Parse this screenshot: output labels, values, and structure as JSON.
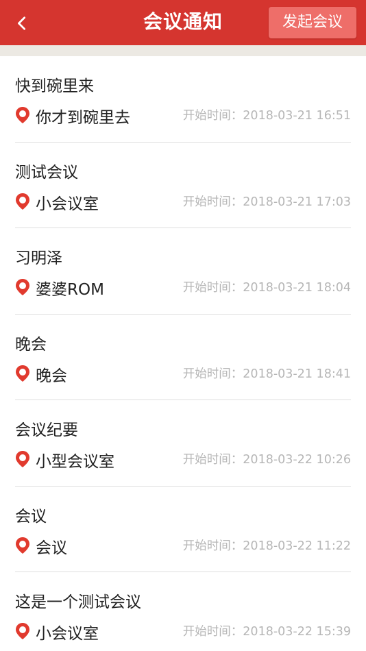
{
  "header": {
    "back_icon": "chevron-left-icon",
    "title": "会议通知",
    "start_meeting_label": "发起会议"
  },
  "colors": {
    "header_bg": "#d5352f",
    "button_bg": "#ee6e69",
    "gap_bg": "#ece9e3",
    "time_text": "#b6b6b6",
    "icon_red": "#e13a2e"
  },
  "location_icon": "location-pin-icon",
  "meetings": [
    {
      "title": "快到碗里来",
      "location": "你才到碗里去",
      "start_time": "开始时间：2018-03-21 16:51"
    },
    {
      "title": "测试会议",
      "location": "小会议室",
      "start_time": "开始时间：2018-03-21 17:03"
    },
    {
      "title": "习明泽",
      "location": "婆婆ROM",
      "start_time": "开始时间：2018-03-21 18:04"
    },
    {
      "title": "晚会",
      "location": "晚会",
      "start_time": "开始时间：2018-03-21 18:41"
    },
    {
      "title": "会议纪要",
      "location": "小型会议室",
      "start_time": "开始时间：2018-03-22 10:26"
    },
    {
      "title": "会议",
      "location": "会议",
      "start_time": "开始时间：2018-03-22 11:22"
    },
    {
      "title": "这是一个测试会议",
      "location": "小会议室",
      "start_time": "开始时间：2018-03-22 15:39"
    }
  ]
}
